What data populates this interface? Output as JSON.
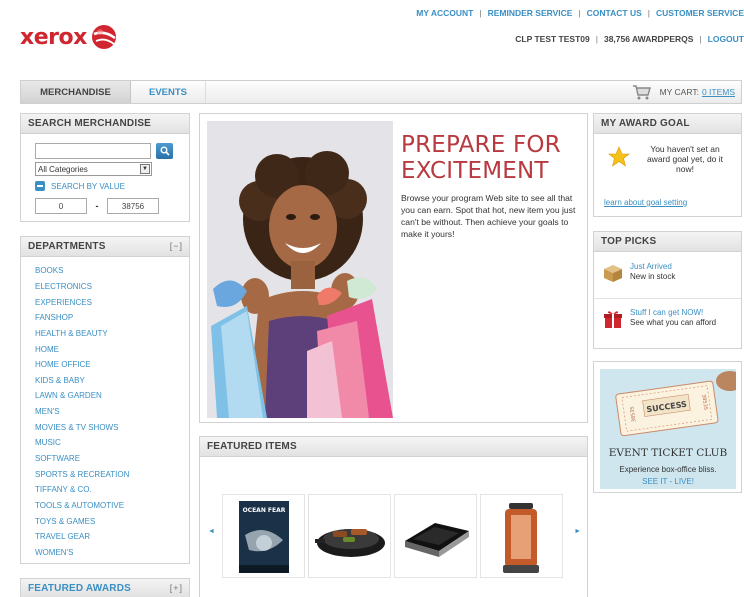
{
  "brand": {
    "logo_text": "xerox",
    "accent": "#d0262f",
    "link_color": "#3a8fc4"
  },
  "header": {
    "links": [
      "MY ACCOUNT",
      "REMINDER SERVICE",
      "CONTACT US",
      "CUSTOMER SERVICE"
    ],
    "user_name": "CLP TEST TEST09",
    "points": "38,756 AWARDPERQS",
    "logout": "LOGOUT"
  },
  "nav": {
    "tabs": [
      "MERCHANDISE",
      "EVENTS"
    ],
    "cart_label": "MY CART:",
    "cart_items": "0 ITEMS"
  },
  "search": {
    "title": "SEARCH MERCHANDISE",
    "input_value": "",
    "category": "All Categories",
    "by_value": "SEARCH BY VALUE",
    "min": "0",
    "max": "38756",
    "range_sep": "-"
  },
  "departments": {
    "title": "DEPARTMENTS",
    "toggle": "[−]",
    "items": [
      "BOOKS",
      "ELECTRONICS",
      "EXPERIENCES",
      "FANSHOP",
      "HEALTH & BEAUTY",
      "HOME",
      "HOME OFFICE",
      "KIDS & BABY",
      "LAWN & GARDEN",
      "MEN'S",
      "MOVIES & TV SHOWS",
      "MUSIC",
      "SOFTWARE",
      "SPORTS & RECREATION",
      "TIFFANY & CO.",
      "TOOLS & AUTOMOTIVE",
      "TOYS & GAMES",
      "TRAVEL GEAR",
      "WOMEN'S"
    ]
  },
  "featured_awards": {
    "title": "FEATURED AWARDS",
    "toggle": "[+]"
  },
  "hero": {
    "title_line1": "PREPARE FOR",
    "title_line2": "EXCITEMENT",
    "body": "Browse your program Web site to see all that you can earn. Spot that hot, new item you just can't be without. Then achieve your goals to make it yours!"
  },
  "featured_items": {
    "title": "FEATURED ITEMS",
    "prev": "◄",
    "next": "►",
    "dvd_title": "OCEAN FEAR"
  },
  "award_goal": {
    "title": "MY AWARD GOAL",
    "message": "You haven't set an award goal yet, do it now!",
    "link": "learn about goal setting"
  },
  "top_picks": {
    "title": "TOP PICKS",
    "items": [
      {
        "link": "Just Arrived",
        "sub": "New in stock",
        "icon": "box-icon"
      },
      {
        "link": "Stuff I can get NOW!",
        "sub": "See what you can afford",
        "icon": "gift-icon"
      }
    ]
  },
  "event_club": {
    "ticket_text": "SUCCESS",
    "ticket_num_left": "38535",
    "ticket_num_right": "38535",
    "title": "EVENT TICKET CLUB",
    "subtitle": "Experience box-office bliss.",
    "link": "SEE IT - LIVE!"
  }
}
